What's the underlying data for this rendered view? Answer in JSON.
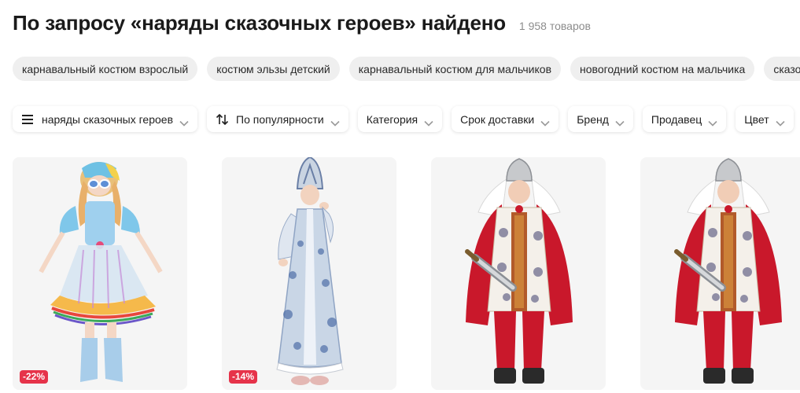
{
  "header": {
    "title": "По запросу «наряды сказочных героев» найдено",
    "count": "1 958 товаров"
  },
  "suggestions": [
    "карнавальный костюм взрослый",
    "костюм эльзы детский",
    "карнавальный костюм для мальчиков",
    "новогодний костюм на мальчика",
    "сказо"
  ],
  "filters": {
    "query": {
      "label": "наряды сказочных героев",
      "icon": "menu-icon"
    },
    "sort": {
      "label": "По популярности",
      "icon": "sort-icon"
    },
    "category": "Категория",
    "delivery": "Срок доставки",
    "brand": "Бренд",
    "seller": "Продавец",
    "color": "Цвет"
  },
  "products": [
    {
      "image": "rainbow-pony-girl-costume",
      "badge": "-22%"
    },
    {
      "image": "russian-sarafan-kokoshnik-costume",
      "badge": "-14%"
    },
    {
      "image": "bogatyr-knight-red-cape-costume",
      "badge": ""
    },
    {
      "image": "bogatyr-knight-red-cape-costume",
      "badge": ""
    }
  ],
  "colors": {
    "badge": "#e6334a",
    "chip_bg": "#efefef",
    "card_bg": "#f5f5f5"
  }
}
